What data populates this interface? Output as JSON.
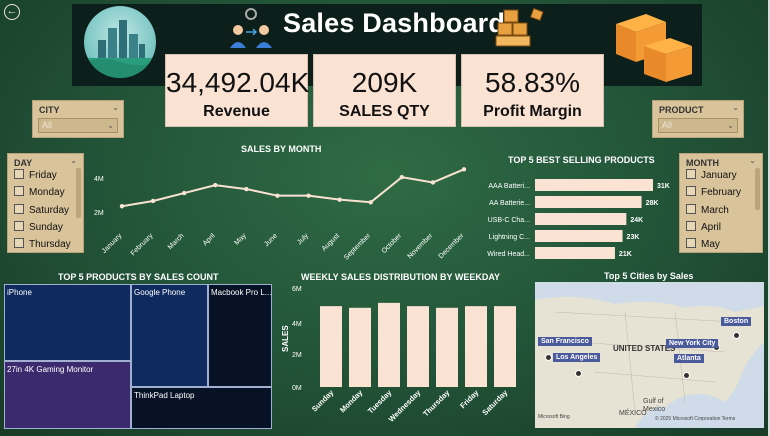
{
  "header": {
    "title": "Sales Dashboard"
  },
  "kpis": [
    {
      "value": "34,492.04K",
      "label": "Revenue"
    },
    {
      "value": "209K",
      "label": "SALES QTY"
    },
    {
      "value": "58.83%",
      "label": "Profit Margin"
    }
  ],
  "city_slicer": {
    "title": "CITY",
    "value": "All"
  },
  "product_slicer": {
    "title": "PRODUCT",
    "value": "All"
  },
  "day_slicer": {
    "title": "DAY",
    "items": [
      "Friday",
      "Monday",
      "Saturday",
      "Sunday",
      "Thursday"
    ]
  },
  "month_slicer": {
    "title": "MONTH",
    "items": [
      "January",
      "February",
      "March",
      "April",
      "May"
    ]
  },
  "sales_by_month": {
    "title": "SALES BY MONTH",
    "yticks": [
      "4M",
      "2M"
    ],
    "chart_data": {
      "type": "line",
      "categories": [
        "January",
        "February",
        "March",
        "April",
        "May",
        "June",
        "July",
        "August",
        "September",
        "October",
        "November",
        "December"
      ],
      "values": [
        1.8,
        2.2,
        2.8,
        3.4,
        3.1,
        2.6,
        2.6,
        2.3,
        2.1,
        4.0,
        3.6,
        4.6
      ],
      "ylim": [
        0,
        5
      ]
    }
  },
  "top5_products": {
    "title": "TOP 5 BEST SELLING PRODUCTS",
    "chart_data": {
      "type": "bar",
      "categories": [
        "AAA Batteri...",
        "AA Batterie...",
        "USB-C Cha...",
        "Lightning C...",
        "Wired Head..."
      ],
      "values": [
        31,
        28,
        24,
        23,
        21
      ],
      "labels": [
        "31K",
        "28K",
        "24K",
        "23K",
        "21K"
      ]
    }
  },
  "treemap": {
    "title": "TOP 5 PRODUCTS BY SALES COUNT",
    "items": [
      "iPhone",
      "Google Phone",
      "Macbook Pro L...",
      "27in 4K Gaming Monitor",
      "ThinkPad Laptop"
    ]
  },
  "weekday_chart": {
    "title": "WEEKLY SALES DISTRIBUTION BY WEEKDAY",
    "ylabel": "SALES",
    "yticks": [
      "6M",
      "4M",
      "2M",
      "0M"
    ],
    "chart_data": {
      "type": "bar",
      "categories": [
        "Sunday",
        "Monday",
        "Tuesday",
        "Wednesday",
        "Thursday",
        "Friday",
        "Saturday"
      ],
      "values": [
        4.9,
        4.8,
        5.1,
        4.9,
        4.8,
        4.9,
        4.9
      ],
      "ylim": [
        0,
        6
      ]
    }
  },
  "map": {
    "title": "Top 5 Cities by Sales",
    "cities": [
      "San Francisco",
      "Los Angeles",
      "New York City",
      "Atlanta",
      "Boston"
    ],
    "labels": {
      "country": "UNITED STATES",
      "gulf": "Gulf of\nMexico",
      "mexico": "MÉXICO",
      "credit": "Microsoft Bing",
      "copyright": "© 2025 Microsoft Corporation  Terms"
    }
  },
  "colors": {
    "accent": "#fbe3d4",
    "slicer": "#d8c39a",
    "treemap_navy": "#0e2a5e",
    "treemap_purple": "#3b2a6e"
  }
}
